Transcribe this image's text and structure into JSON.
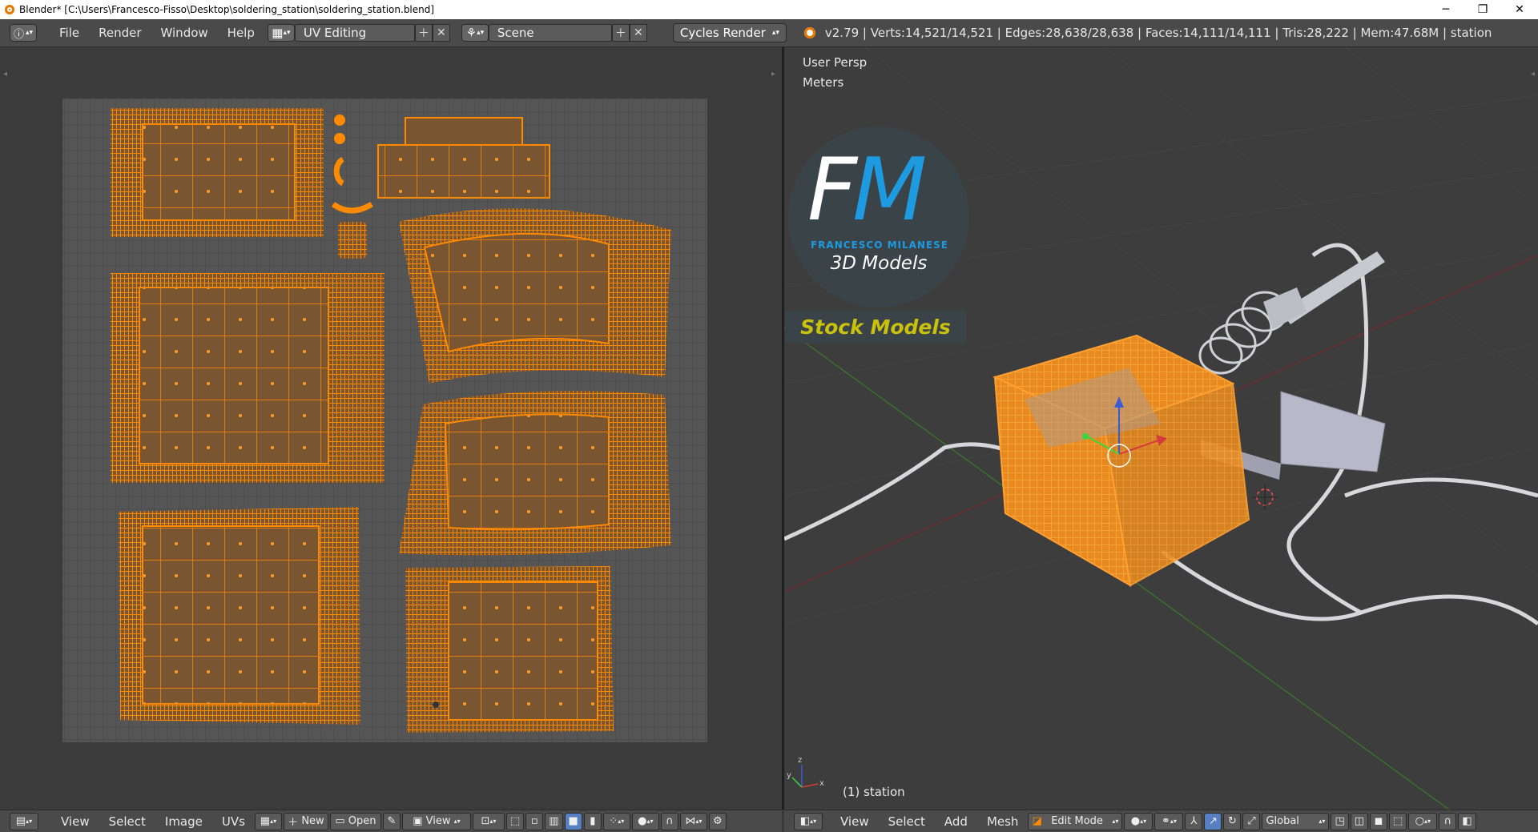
{
  "window": {
    "title": "Blender* [C:\\Users\\Francesco-Fisso\\Desktop\\soldering_station\\soldering_station.blend]",
    "minimize": "─",
    "restore": "❐",
    "close": "✕"
  },
  "topbar": {
    "menus": [
      "File",
      "Render",
      "Window",
      "Help"
    ],
    "screen_layout": "UV Editing",
    "scene": "Scene",
    "render_engine": "Cycles Render",
    "stats": "v2.79 | Verts:14,521/14,521 | Edges:28,638/28,638 | Faces:14,111/14,111 | Tris:28,222 | Mem:47.68M | station"
  },
  "uv_editor": {
    "menus": [
      "View",
      "Select",
      "Image",
      "UVs"
    ],
    "new_label": "New",
    "open_label": "Open",
    "view_label": "View"
  },
  "viewport": {
    "view_name": "User Persp",
    "units": "Meters",
    "object_label": "(1) station",
    "logo": {
      "monogram_f": "F",
      "monogram_m": "M",
      "name": "FRANCESCO MILANESE",
      "subtitle": "3D Models",
      "banner": "Stock Models"
    },
    "menus": [
      "View",
      "Select",
      "Add",
      "Mesh"
    ],
    "mode": "Edit Mode",
    "orientation": "Global"
  },
  "colors": {
    "uv_orange": "#ff8a00",
    "face_fill": "#7a5532",
    "select_blue": "#5680c2",
    "logo_blue": "#1e9be0",
    "banner_yellow": "#c9c10c"
  }
}
